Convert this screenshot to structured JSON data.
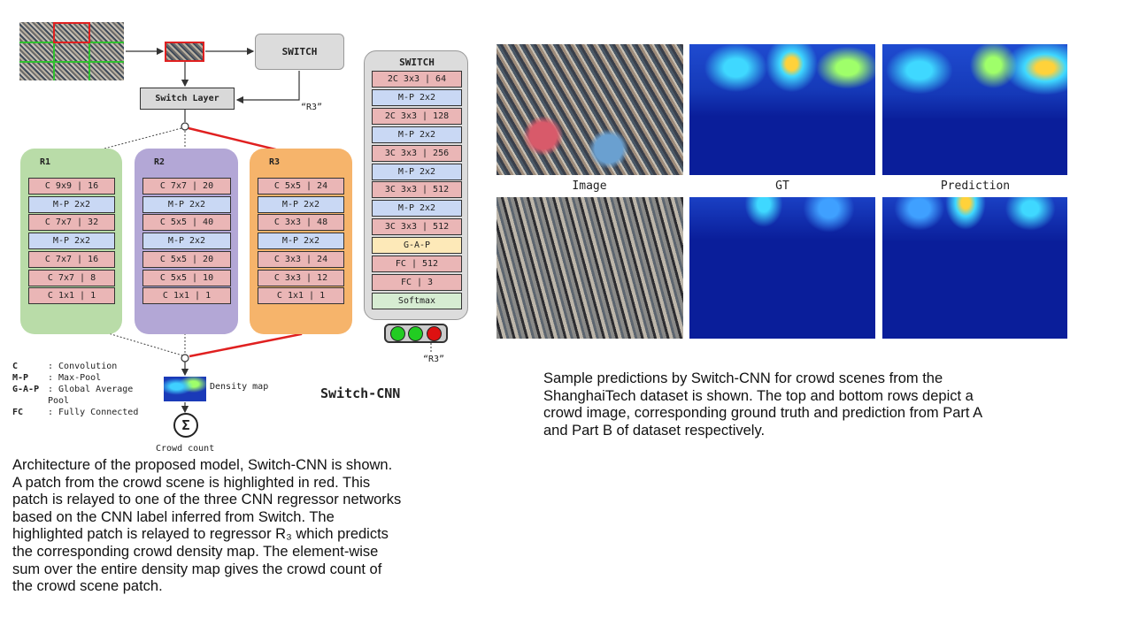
{
  "switch_box_label": "SWITCH",
  "switch_layer_label": "Switch Layer",
  "r3_label_top": "“R3”",
  "r3_label_bottom": "“R3”",
  "regressors": [
    {
      "name": "R1",
      "color": "#b9dca8",
      "layers": [
        {
          "label": "C 9x9 | 16",
          "kind": "conv"
        },
        {
          "label": "M-P 2x2",
          "kind": "pool"
        },
        {
          "label": "C 7x7 | 32",
          "kind": "conv"
        },
        {
          "label": "M-P 2x2",
          "kind": "pool"
        },
        {
          "label": "C 7x7 | 16",
          "kind": "conv"
        },
        {
          "label": "C 7x7 | 8",
          "kind": "conv"
        },
        {
          "label": "C 1x1 | 1",
          "kind": "conv"
        }
      ]
    },
    {
      "name": "R2",
      "color": "#b3a7d6",
      "layers": [
        {
          "label": "C 7x7 | 20",
          "kind": "conv"
        },
        {
          "label": "M-P 2x2",
          "kind": "pool"
        },
        {
          "label": "C 5x5 | 40",
          "kind": "conv"
        },
        {
          "label": "M-P 2x2",
          "kind": "pool"
        },
        {
          "label": "C 5x5 | 20",
          "kind": "conv"
        },
        {
          "label": "C 5x5 | 10",
          "kind": "conv"
        },
        {
          "label": "C 1x1 | 1",
          "kind": "conv"
        }
      ]
    },
    {
      "name": "R3",
      "color": "#f6b46b",
      "layers": [
        {
          "label": "C 5x5 | 24",
          "kind": "conv"
        },
        {
          "label": "M-P 2x2",
          "kind": "pool"
        },
        {
          "label": "C 3x3 | 48",
          "kind": "conv"
        },
        {
          "label": "M-P 2x2",
          "kind": "pool"
        },
        {
          "label": "C 3x3 | 24",
          "kind": "conv"
        },
        {
          "label": "C 3x3 | 12",
          "kind": "conv"
        },
        {
          "label": "C 1x1 | 1",
          "kind": "conv"
        }
      ]
    }
  ],
  "switch_network": {
    "title": "SWITCH",
    "color": "#dcdcdc",
    "layers": [
      {
        "label": "2C 3x3 | 64",
        "kind": "conv"
      },
      {
        "label": "M-P 2x2",
        "kind": "pool"
      },
      {
        "label": "2C 3x3 | 128",
        "kind": "conv"
      },
      {
        "label": "M-P 2x2",
        "kind": "pool"
      },
      {
        "label": "3C 3x3 | 256",
        "kind": "conv"
      },
      {
        "label": "M-P 2x2",
        "kind": "pool"
      },
      {
        "label": "3C 3x3 | 512",
        "kind": "conv"
      },
      {
        "label": "M-P 2x2",
        "kind": "pool"
      },
      {
        "label": "3C 3x3 | 512",
        "kind": "conv"
      },
      {
        "label": "G-A-P",
        "kind": "gap"
      },
      {
        "label": "FC | 512",
        "kind": "conv"
      },
      {
        "label": "FC | 3",
        "kind": "conv"
      },
      {
        "label": "Softmax",
        "kind": "soft"
      }
    ],
    "lights": [
      "#22cc22",
      "#22cc22",
      "#dd1111"
    ]
  },
  "legend": [
    {
      "key": "C",
      "value": ": Convolution"
    },
    {
      "key": "M-P",
      "value": ": Max-Pool"
    },
    {
      "key": "G-A-P",
      "value": ": Global Average"
    },
    {
      "key": "",
      "value": "Pool"
    },
    {
      "key": "FC",
      "value": ": Fully Connected"
    }
  ],
  "density_map_label": "Density map",
  "sum_symbol": "Σ",
  "crowd_count_label": "Crowd count",
  "model_name": "Switch-CNN",
  "left_caption": [
    "Architecture of the proposed model, Switch-CNN is shown.",
    "A patch from the crowd scene is highlighted in red. This",
    "patch is relayed to one of the three CNN regressor networks",
    "based on the CNN label inferred from Switch. The",
    "highlighted patch is relayed to regressor R₃ which predicts",
    "the corresponding crowd density map. The element-wise",
    "sum over the entire density map gives the crowd count of",
    "the crowd scene patch."
  ],
  "results": {
    "column_labels": [
      "Image",
      "GT",
      "Prediction"
    ]
  },
  "right_caption": [
    "Sample predictions by Switch-CNN for crowd scenes from the",
    "ShanghaiTech dataset is shown. The top and bottom rows depict a",
    "crowd image, corresponding ground truth and prediction from Part A",
    "and Part B of dataset respectively."
  ],
  "colors": {
    "red": "#e02020",
    "heatmap_bg": "#0a1e9a",
    "heatmap_hot": "#ffd23a"
  }
}
